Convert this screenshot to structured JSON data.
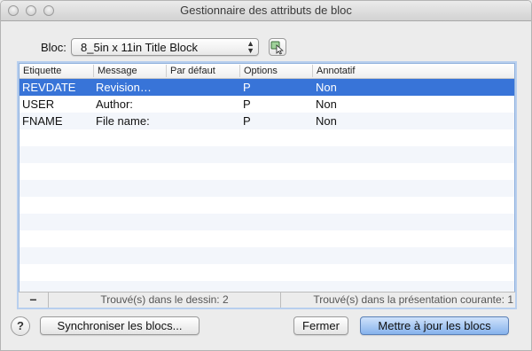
{
  "window": {
    "title": "Gestionnaire des attributs de bloc"
  },
  "bloc": {
    "label": "Bloc:",
    "selected": "8_5in x 11in Title Block",
    "pick_icon": "select-objects-icon"
  },
  "table": {
    "columns": [
      "Etiquette",
      "Message",
      "Par défaut",
      "Options",
      "Annotatif"
    ],
    "rows": [
      {
        "tag": "REVDATE",
        "prompt": "Revision…",
        "default": "",
        "options": "P",
        "annotative": "Non"
      },
      {
        "tag": "USER",
        "prompt": "Author:",
        "default": "",
        "options": "P",
        "annotative": "Non"
      },
      {
        "tag": "FNAME",
        "prompt": "File name:",
        "default": "",
        "options": "P",
        "annotative": "Non"
      }
    ]
  },
  "status": {
    "remove_label": "−",
    "found_in_drawing": "Trouvé(s) dans le dessin: 2",
    "found_in_layout": "Trouvé(s) dans la présentation courante: 1"
  },
  "buttons": {
    "help": "?",
    "sync": "Synchroniser les blocs...",
    "close": "Fermer",
    "update": "Mettre à jour les blocs"
  },
  "colors": {
    "selection": "#3874d8",
    "default_button": "#86b2ec",
    "table_focus": "#b8cfee"
  }
}
